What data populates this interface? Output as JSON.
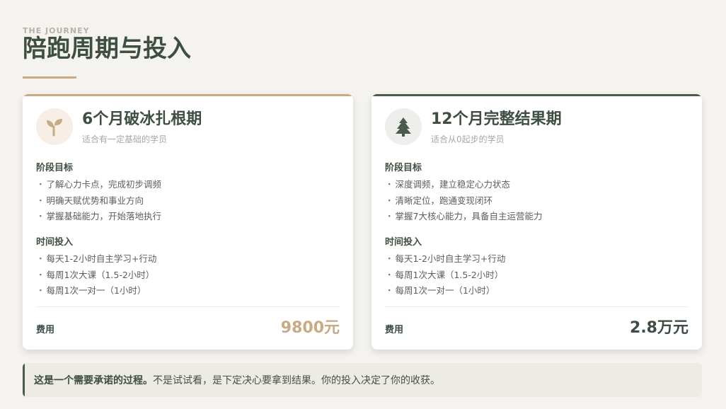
{
  "header": {
    "eyebrow": "THE JOURNEY",
    "title": "陪跑周期与投入"
  },
  "colors": {
    "accent_tan": "#c8aa84",
    "accent_green": "#4a5a4c",
    "background": "#f5f3ef"
  },
  "plans": [
    {
      "icon": "sprout-icon",
      "title": "6个月破冰扎根期",
      "subtitle": "适合有一定基础的学员",
      "goals_heading": "阶段目标",
      "goals": [
        "了解心力卡点，完成初步调频",
        "明确天赋优势和事业方向",
        "掌握基础能力，开始落地执行"
      ],
      "time_heading": "时间投入",
      "time": [
        "每天1-2小时自主学习+行动",
        "每周1次大课（1.5-2小时）",
        "每周1次一对一（1小时）"
      ],
      "fee_label": "费用",
      "price": "9800元"
    },
    {
      "icon": "pine-tree-icon",
      "title": "12个月完整结果期",
      "subtitle": "适合从0起步的学员",
      "goals_heading": "阶段目标",
      "goals": [
        "深度调频，建立稳定心力状态",
        "清晰定位，跑通变现闭环",
        "掌握7大核心能力，具备自主运营能力"
      ],
      "time_heading": "时间投入",
      "time": [
        "每天1-2小时自主学习+行动",
        "每周1次大课（1.5-2小时）",
        "每周1次一对一（1小时）"
      ],
      "fee_label": "费用",
      "price": "2.8万元"
    }
  ],
  "note": {
    "bold": "这是一个需要承诺的过程。",
    "text": "不是试试看，是下定决心要拿到结果。你的投入决定了你的收获。"
  }
}
